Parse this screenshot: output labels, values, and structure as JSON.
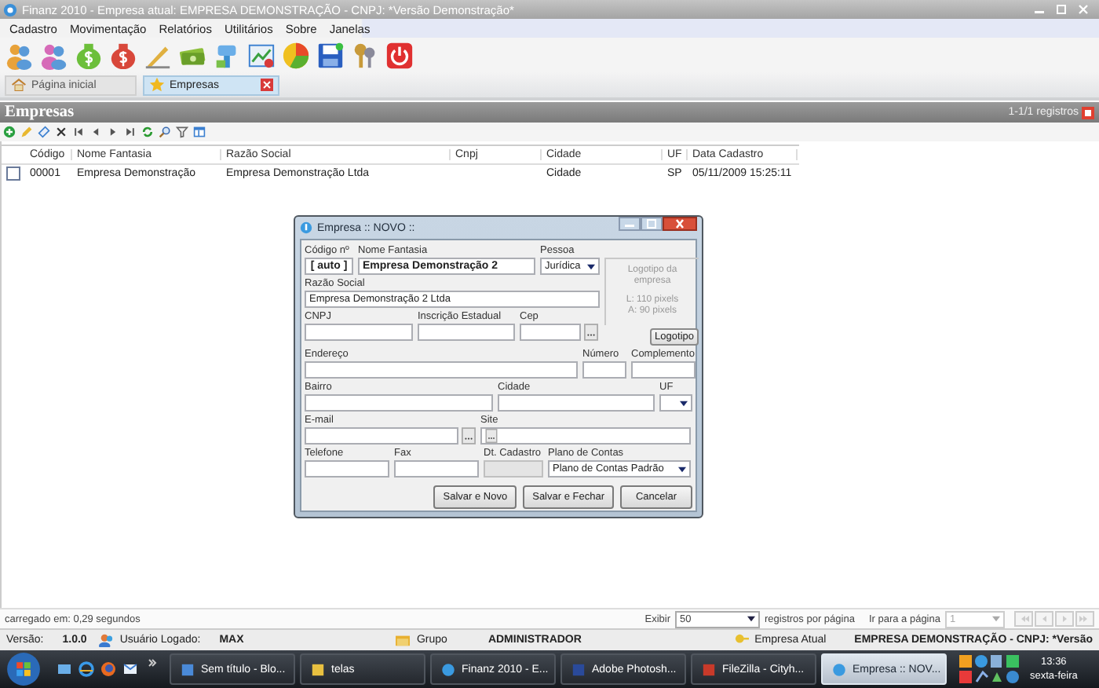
{
  "window": {
    "title": "Finanz 2010 - Empresa atual: EMPRESA DEMONSTRAÇÃO - CNPJ:  *Versão Demonstração*"
  },
  "menu": [
    "Cadastro",
    "Movimentação",
    "Relatórios",
    "Utilitários",
    "Sobre",
    "Janelas"
  ],
  "tabs": [
    {
      "label": "Página inicial",
      "selected": false
    },
    {
      "label": "Empresas",
      "selected": true
    }
  ],
  "panel": {
    "title": "Empresas",
    "record_count": "1-1/1 registros"
  },
  "table": {
    "columns": [
      "Código",
      "Nome Fantasia",
      "Razão Social",
      "Cnpj",
      "Cidade",
      "UF",
      "Data Cadastro"
    ],
    "rows": [
      {
        "checked": false,
        "cells": [
          "00001",
          "Empresa Demonstração",
          "Empresa Demonstração Ltda",
          null,
          "Cidade",
          "SP",
          "05/11/2009 15:25:11"
        ]
      }
    ]
  },
  "dialog": {
    "title": "Empresa :: NOVO ::",
    "fields": {
      "codigo": {
        "label": "Código nº",
        "kind": "code",
        "value": "[ auto ]"
      },
      "nome_fantasia": {
        "label": "Nome Fantasia",
        "kind": "text",
        "value": "Empresa Demonstração 2",
        "bold": true
      },
      "pessoa": {
        "label": "Pessoa",
        "kind": "select",
        "value": "Jurídica"
      },
      "razao_social": {
        "label": "Razão Social",
        "kind": "text",
        "value": "Empresa Demonstração 2 Ltda"
      },
      "cnpj": {
        "label": "CNPJ",
        "kind": "text"
      },
      "inscricao_estadual": {
        "label": "Inscrição Estadual",
        "kind": "text"
      },
      "cep": {
        "label": "Cep",
        "kind": "lookup"
      },
      "endereco": {
        "label": "Endereço",
        "kind": "text"
      },
      "numero": {
        "label": "Número",
        "kind": "text"
      },
      "complemento": {
        "label": "Complemento",
        "kind": "text"
      },
      "bairro": {
        "label": "Bairro",
        "kind": "text"
      },
      "cidade": {
        "label": "Cidade",
        "kind": "text"
      },
      "uf": {
        "label": "UF",
        "kind": "select"
      },
      "email": {
        "label": "E-mail",
        "kind": "lookup"
      },
      "site": {
        "label": "Site",
        "kind": "inner_lookup"
      },
      "telefone": {
        "label": "Telefone",
        "kind": "text"
      },
      "fax": {
        "label": "Fax",
        "kind": "text"
      },
      "dt_cadastro": {
        "label": "Dt. Cadastro",
        "kind": "disabled"
      },
      "plano_de_contas": {
        "label": "Plano de Contas",
        "kind": "select",
        "value": "Plano de Contas Padrão"
      }
    },
    "logo_hint": [
      "Logotipo da empresa",
      "L: 110 pixels",
      "A: 90 pixels"
    ],
    "logo_button": "Logotipo",
    "buttons": [
      "Salvar e Novo",
      "Salvar e Fechar",
      "Cancelar"
    ]
  },
  "load_time": "carregado em: 0,29 segundos",
  "pager": {
    "show_label": "Exibir",
    "page_size": "50",
    "per_page_label": "registros por página",
    "goto_label": "Ir para a página",
    "page": "1"
  },
  "status_bar": [
    {
      "label": "Versão:",
      "value": "1.0.0"
    },
    {
      "label": "Usuário Logado:",
      "value": "MAX"
    },
    {
      "label": "Grupo",
      "value": "ADMINISTRADOR"
    },
    {
      "label": "Empresa Atual",
      "value": "EMPRESA DEMONSTRAÇÃO - CNPJ:  *Versão"
    }
  ],
  "taskbar": {
    "buttons": [
      {
        "label": "Sem título - Blo...",
        "selected": false
      },
      {
        "label": "telas",
        "selected": false
      },
      {
        "label": "Finanz 2010 - E...",
        "selected": false
      },
      {
        "label": "Adobe Photosh...",
        "selected": false
      },
      {
        "label": "FileZilla - Cityh...",
        "selected": false
      },
      {
        "label": "Empresa :: NOV...",
        "selected": true
      }
    ],
    "time": "13:36",
    "day": "sexta-feira"
  }
}
